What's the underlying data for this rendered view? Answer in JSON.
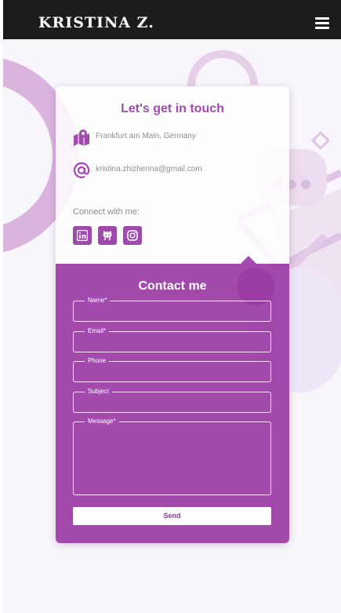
{
  "header": {
    "brand": "KRISTINA Z.",
    "menu_icon": "hamburger-menu-icon"
  },
  "contact_info": {
    "title": "Let's get in touch",
    "address": "Frankfurt am Main, Germany",
    "address_icon": "map-icon",
    "email": "kristina.zhizherina@gmail.com",
    "email_icon": "at-sign-icon",
    "connect_label": "Connect with me:",
    "socials": [
      "linkedin-icon",
      "github-icon",
      "instagram-icon"
    ]
  },
  "form": {
    "title": "Contact me",
    "name_label": "Name*",
    "email_label": "Email*",
    "phone_label": "Phone",
    "subject_label": "Subject",
    "message_label": "Message*",
    "send_label": "Send"
  },
  "colors": {
    "header_bg": "#1e1b1b",
    "accent": "#a04aae",
    "form_bg": "#9936a3",
    "page_bg": "#f8f6fc"
  }
}
